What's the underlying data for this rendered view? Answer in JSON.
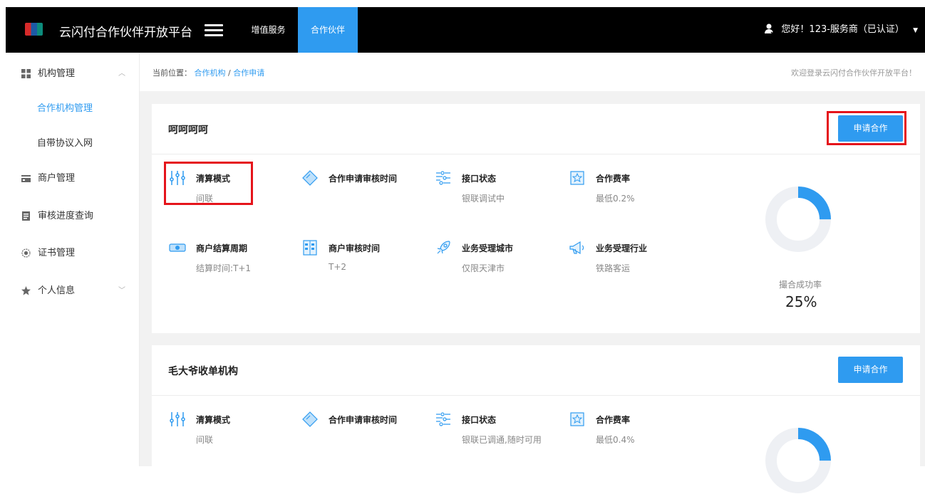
{
  "header": {
    "app_title": "云闪付合作伙伴开放平台",
    "nav": [
      "增值服务",
      "合作伙伴"
    ],
    "active_nav": "合作伙伴",
    "user_text": "您好！123-服务商（已认证）",
    "icons": [
      "unionpay-logo-icon",
      "hamburger-icon",
      "user-icon",
      "caret-down-icon"
    ],
    "accent_color": "#2f9bf0",
    "bar_color": "#000000"
  },
  "sidebar": {
    "items": [
      {
        "label": "机构管理",
        "icon": "grid-icon",
        "expanded": true
      },
      {
        "label": "商户管理",
        "icon": "card-icon"
      },
      {
        "label": "审核进度查询",
        "icon": "doc-icon"
      },
      {
        "label": "证书管理",
        "icon": "target-icon"
      },
      {
        "label": "个人信息",
        "icon": "star-icon"
      }
    ],
    "sub_items": [
      {
        "label": "合作机构管理",
        "active": true
      },
      {
        "label": "自带协议入网",
        "active": false
      }
    ]
  },
  "breadcrumb": {
    "prefix": "当前位置：",
    "parts": [
      "合作机构",
      "/",
      "合作申请"
    ],
    "welcome": "欢迎登录云闪付合作伙伴开放平台！"
  },
  "cards": [
    {
      "title": "呵呵呵呵",
      "apply_label": "申请合作",
      "features": [
        {
          "title": "清算模式",
          "value": "间联",
          "icon": "sliders-icon"
        },
        {
          "title": "合作申请审核时间",
          "value": "",
          "icon": "diamond-icon"
        },
        {
          "title": "接口状态",
          "value": "银联调试中",
          "icon": "interface-icon"
        },
        {
          "title": "合作费率",
          "value": "最低0.2%",
          "icon": "rate-icon"
        },
        {
          "title": "商户结算周期",
          "value": "结算时间:T+1",
          "icon": "settle-icon"
        },
        {
          "title": "商户审核时间",
          "value": "T+2",
          "icon": "building-icon"
        },
        {
          "title": "业务受理城市",
          "value": "仅限天津市",
          "icon": "rocket-icon"
        },
        {
          "title": "业务受理行业",
          "value": "铁路客运",
          "icon": "megaphone-icon"
        }
      ],
      "rate_label": "撮合成功率",
      "rate_value": "25%",
      "rate_fraction": 0.25
    },
    {
      "title": "毛大爷收单机构",
      "apply_label": "申请合作",
      "features": [
        {
          "title": "清算模式",
          "value": "间联",
          "icon": "sliders-icon"
        },
        {
          "title": "合作申请审核时间",
          "value": "",
          "icon": "diamond-icon"
        },
        {
          "title": "接口状态",
          "value": "银联已调通,随时可用",
          "icon": "interface-icon"
        },
        {
          "title": "合作费率",
          "value": "最低0.4%",
          "icon": "rate-icon"
        }
      ],
      "rate_fraction": 0.25
    }
  ]
}
